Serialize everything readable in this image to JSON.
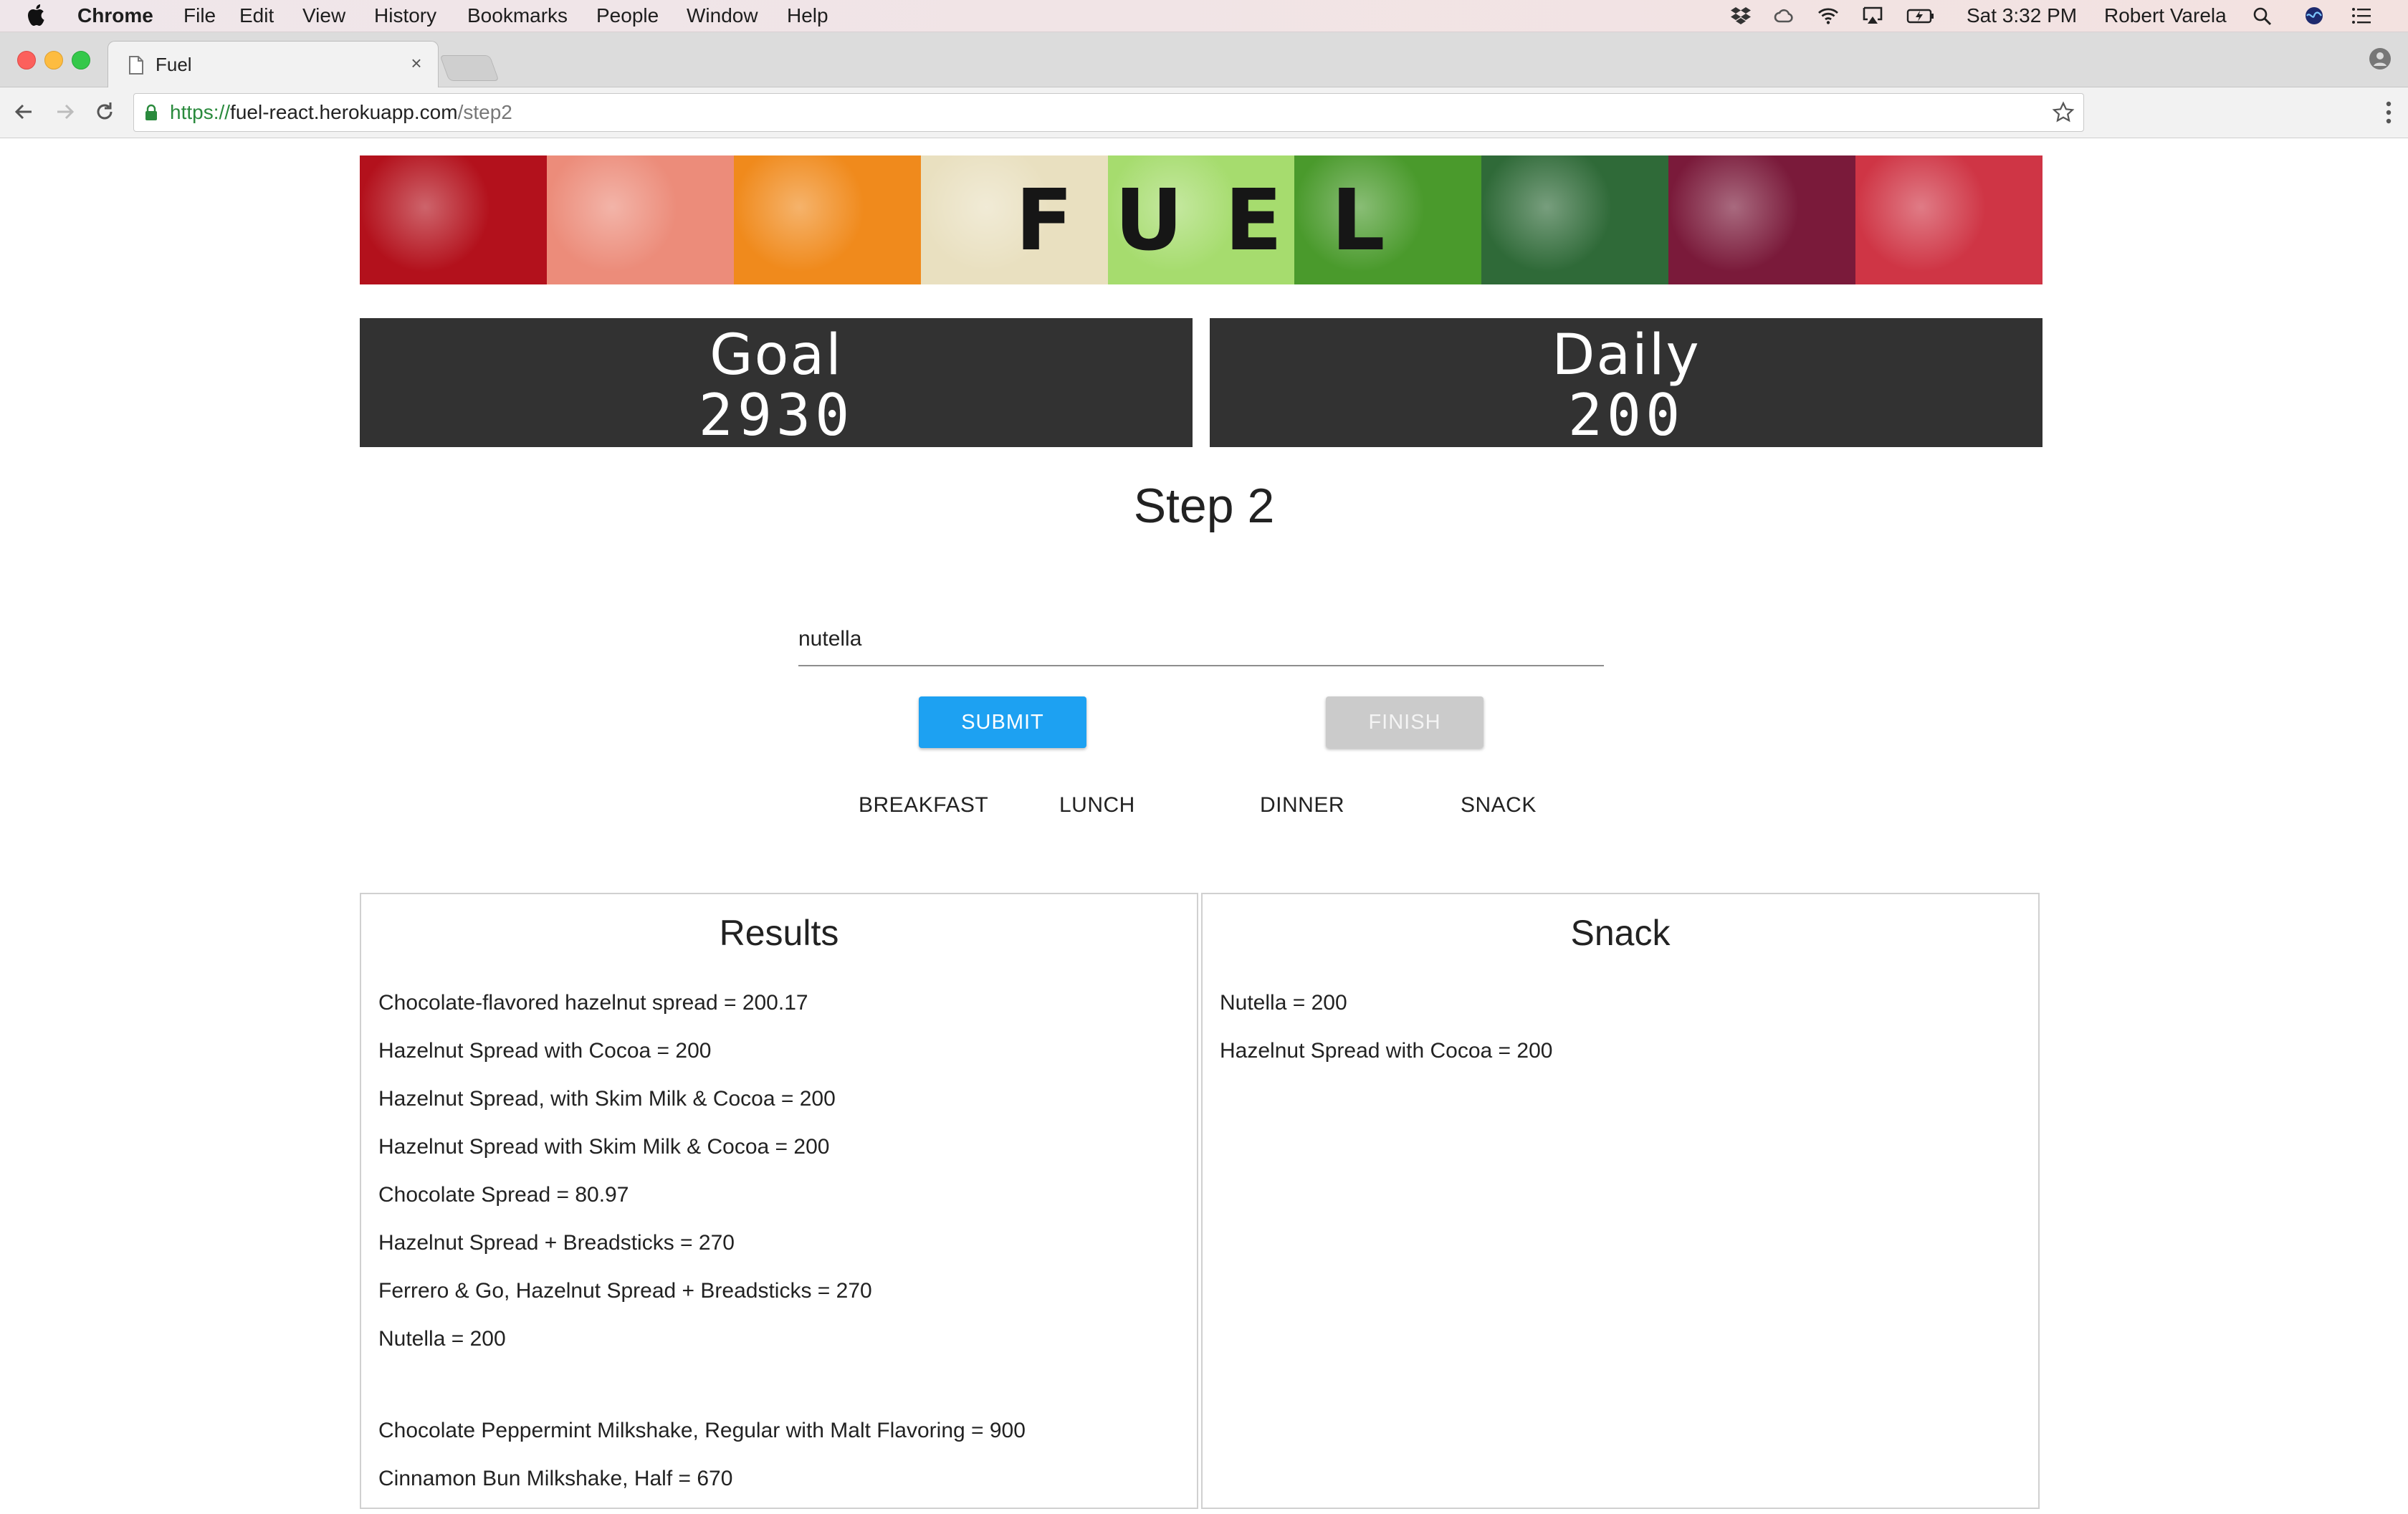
{
  "menubar": {
    "app_name": "Chrome",
    "items": [
      "File",
      "Edit",
      "View",
      "History",
      "Bookmarks",
      "People",
      "Window",
      "Help"
    ],
    "clock": "Sat 3:32 PM",
    "user": "Robert Varela"
  },
  "browser": {
    "tab_title": "Fuel",
    "tab_close": "×",
    "url_scheme": "https://",
    "url_host": "fuel-react.herokuapp.com",
    "url_path": "/step2"
  },
  "banner": {
    "letters": [
      "F",
      "U",
      "E",
      "L"
    ],
    "tile_colors": [
      "#b3111c",
      "#ec8c7a",
      "#f08a1c",
      "#e9e0c0",
      "#a6dc6e",
      "#4a9a2c",
      "#2f6a38",
      "#7a1a3a",
      "#cf3545"
    ]
  },
  "stats": {
    "goal_label": "Goal",
    "goal_value": "2930",
    "daily_label": "Daily",
    "daily_value": "200"
  },
  "step": {
    "title": "Step 2"
  },
  "search": {
    "value": "nutella"
  },
  "buttons": {
    "submit": "SUBMIT",
    "finish": "FINISH"
  },
  "meal_tabs": [
    "BREAKFAST",
    "LUNCH",
    "DINNER",
    "SNACK"
  ],
  "results": {
    "title": "Results",
    "items": [
      "Chocolate-flavored hazelnut spread = 200.17",
      "Hazelnut Spread with Cocoa = 200",
      "Hazelnut Spread, with Skim Milk & Cocoa = 200",
      "Hazelnut Spread with Skim Milk & Cocoa = 200",
      "Chocolate Spread = 80.97",
      "Hazelnut Spread + Breadsticks = 270",
      "Ferrero & Go, Hazelnut Spread + Breadsticks = 270",
      "Nutella = 200",
      "",
      "Chocolate Peppermint Milkshake, Regular with Malt Flavoring = 900",
      "Cinnamon Bun Milkshake, Half = 670"
    ]
  },
  "snack": {
    "title": "Snack",
    "items": [
      "Nutella = 200",
      "Hazelnut Spread with Cocoa = 200"
    ]
  },
  "colors": {
    "submit_bg": "#1da1f2",
    "finish_bg": "#cbcbcb",
    "stat_card_bg": "#323232",
    "url_scheme": "#2a8a3d"
  }
}
